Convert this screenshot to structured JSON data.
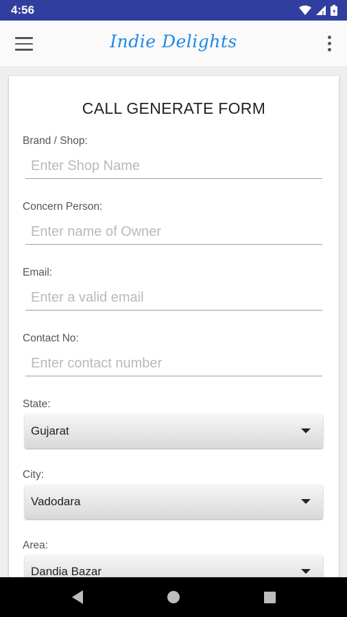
{
  "status_bar": {
    "time": "4:56",
    "icons": [
      "wifi-icon",
      "signal-icon",
      "battery-icon"
    ]
  },
  "app_bar": {
    "title": "Indie Delights",
    "menu_icon": "hamburger-menu-icon",
    "overflow_icon": "more-vert-icon"
  },
  "form": {
    "title": "CALL GENERATE FORM",
    "brand": {
      "label": "Brand / Shop:",
      "placeholder": "Enter Shop Name",
      "value": ""
    },
    "person": {
      "label": "Concern Person:",
      "placeholder": "Enter name of Owner",
      "value": ""
    },
    "email": {
      "label": "Email:",
      "placeholder": "Enter a valid email",
      "value": ""
    },
    "contact": {
      "label": "Contact No:",
      "placeholder": "Enter contact number",
      "value": ""
    },
    "state": {
      "label": "State:",
      "selected": "Gujarat"
    },
    "city": {
      "label": "City:",
      "selected": "Vadodara"
    },
    "area": {
      "label": "Area:",
      "selected": "Dandia Bazar"
    }
  },
  "nav_bar": {
    "icons": [
      "back-icon",
      "home-icon",
      "recents-icon"
    ]
  },
  "colors": {
    "status_bar": "#303f9f",
    "logo": "#1e88e5"
  }
}
